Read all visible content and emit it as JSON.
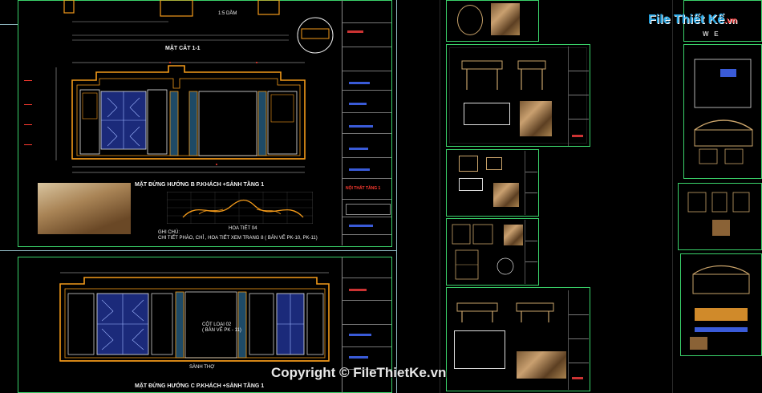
{
  "top_sheet": {
    "scale_note": "1:5 DẦM",
    "section_title": "MẶT CẮT 1-1",
    "elev_title": "MẶT ĐỨNG HƯỚNG B P.KHÁCH +SẢNH TẦNG 1",
    "ornament_title": "HOA  TIẾT 04",
    "note_label": "GHI CHÚ:",
    "note_text": "CHI TIẾT PHÀO, CHỈ , HOA TIẾT XEM TRANG 8 ( BẢN VẼ PK-10, PK-11)",
    "red_label": "NỘI THẤT TẦNG 1"
  },
  "bottom_sheet": {
    "elev_title": "MẶT ĐỨNG HƯỚNG C P.KHÁCH +SẢNH TẦNG 1",
    "col_note": "CỘT LOẠI 02",
    "col_note_sub": "( BẢN VẼ PK - 11)",
    "floor_label": "SÀNH THỢ"
  },
  "logo": {
    "brand": "File Thiết Kế",
    "suffix": ".vn",
    "compass": "W   E"
  },
  "watermark": "Copyright © FileThietKe.vn"
}
